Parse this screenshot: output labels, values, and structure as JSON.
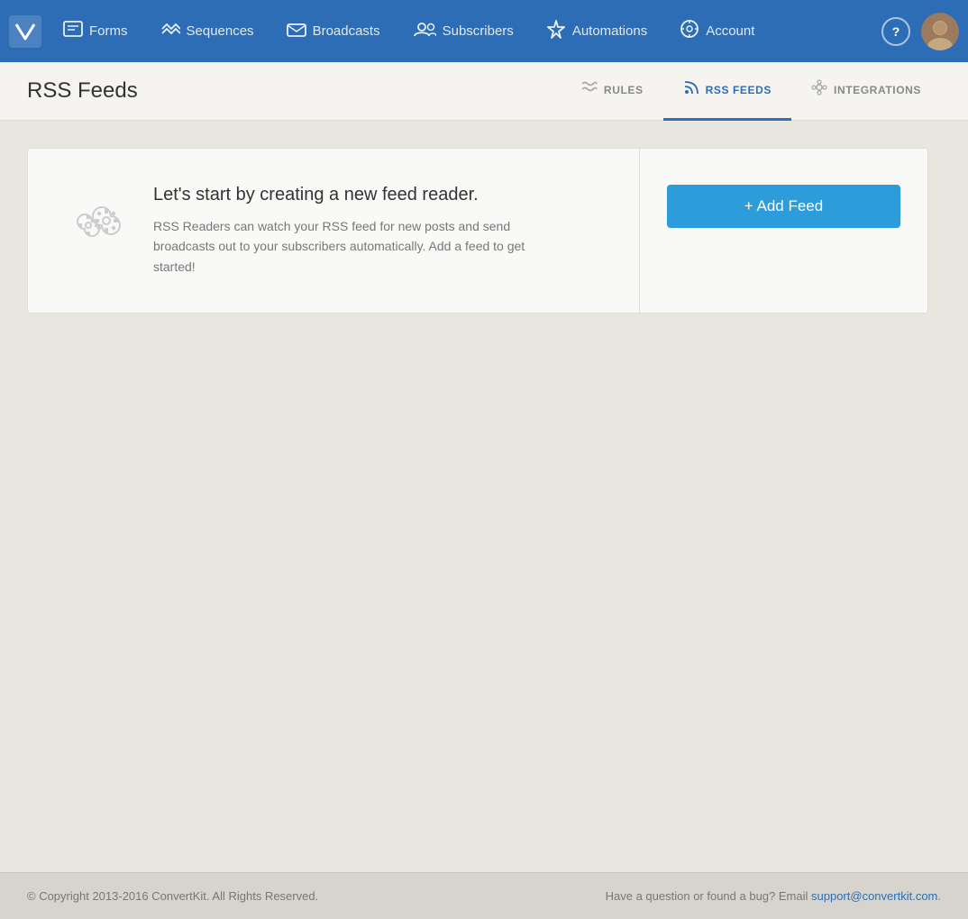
{
  "nav": {
    "items": [
      {
        "label": "Forms",
        "icon": "▤",
        "name": "forms"
      },
      {
        "label": "Sequences",
        "icon": "≪",
        "name": "sequences"
      },
      {
        "label": "Broadcasts",
        "icon": "✉",
        "name": "broadcasts"
      },
      {
        "label": "Subscribers",
        "icon": "👥",
        "name": "subscribers"
      },
      {
        "label": "Automations",
        "icon": "⚡",
        "name": "automations"
      },
      {
        "label": "Account",
        "icon": "⚙",
        "name": "account"
      }
    ],
    "help_label": "?",
    "avatar_alt": "User Avatar"
  },
  "sub_header": {
    "page_title": "RSS Feeds",
    "nav_items": [
      {
        "label": "RULES",
        "icon": "~",
        "name": "rules",
        "active": false
      },
      {
        "label": "RSS FEEDS",
        "icon": "📡",
        "name": "rss-feeds",
        "active": true
      },
      {
        "label": "INTEGRATIONS",
        "icon": "✳",
        "name": "integrations",
        "active": false
      }
    ]
  },
  "card": {
    "heading": "Let's start by creating a new feed reader.",
    "description": "RSS Readers can watch your RSS feed for new posts and send broadcasts out to your subscribers automatically. Add a feed to get started!",
    "add_button_label": "+ Add Feed"
  },
  "footer": {
    "copyright": "© Copyright 2013-2016 ConvertKit. All Rights Reserved.",
    "support_text": "Have a question or found a bug? Email",
    "support_email": "support@convertkit.com"
  }
}
